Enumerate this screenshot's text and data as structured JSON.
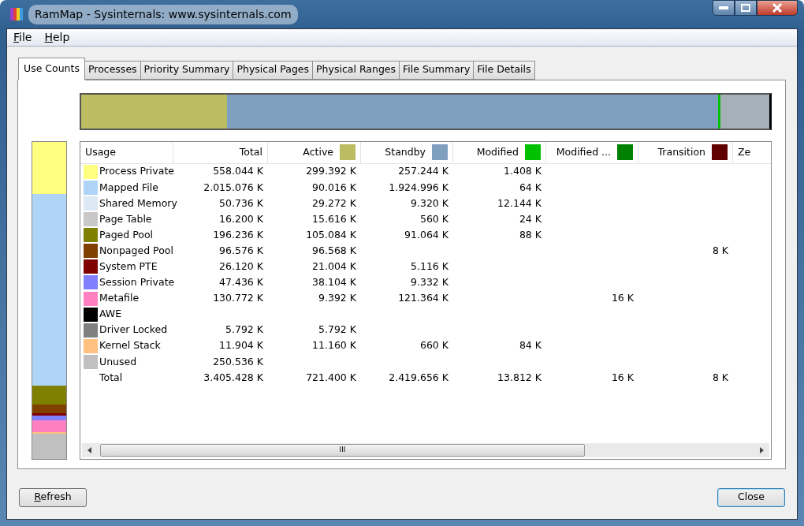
{
  "window": {
    "title": "RamMap - Sysinternals: www.sysinternals.com"
  },
  "menu": [
    {
      "label": "File"
    },
    {
      "label": "Help"
    }
  ],
  "tabs": [
    {
      "label": "Use Counts",
      "selected": true
    },
    {
      "label": "Processes",
      "selected": false
    },
    {
      "label": "Priority Summary",
      "selected": false
    },
    {
      "label": "Physical Pages",
      "selected": false
    },
    {
      "label": "Physical Ranges",
      "selected": false
    },
    {
      "label": "File Summary",
      "selected": false
    },
    {
      "label": "File Details",
      "selected": false
    }
  ],
  "table": {
    "columns": [
      {
        "label": "Usage"
      },
      {
        "label": "Total"
      },
      {
        "label": "Active",
        "color": "#bcbc62"
      },
      {
        "label": "Standby",
        "color": "#7f9fbf"
      },
      {
        "label": "Modified",
        "color": "#00c000"
      },
      {
        "label": "Modified ...",
        "color": "#008000"
      },
      {
        "label": "Transition",
        "color": "#600000"
      },
      {
        "label": "Ze"
      }
    ],
    "rows": [
      {
        "color": "#ffff80",
        "cells": [
          "Process Private",
          "558.044 K",
          "299.392 K",
          "257.244 K",
          "1.408 K",
          null,
          null,
          null
        ]
      },
      {
        "color": "#b0d4f8",
        "cells": [
          "Mapped File",
          "2.015.076 K",
          "90.016 K",
          "1.924.996 K",
          "64 K",
          null,
          null,
          null
        ]
      },
      {
        "color": "#dce8f4",
        "cells": [
          "Shared Memory",
          "50.736 K",
          "29.272 K",
          "9.320 K",
          "12.144 K",
          null,
          null,
          null
        ]
      },
      {
        "color": "#c8c8c8",
        "cells": [
          "Page Table",
          "16.200 K",
          "15.616 K",
          "560 K",
          "24 K",
          null,
          null,
          null
        ]
      },
      {
        "color": "#808000",
        "cells": [
          "Paged Pool",
          "196.236 K",
          "105.084 K",
          "91.064 K",
          "88 K",
          null,
          null,
          null
        ]
      },
      {
        "color": "#804000",
        "cells": [
          "Nonpaged Pool",
          "96.576 K",
          "96.568 K",
          null,
          null,
          null,
          "8 K",
          null
        ]
      },
      {
        "color": "#800000",
        "cells": [
          "System PTE",
          "26.120 K",
          "21.004 K",
          "5.116 K",
          null,
          null,
          null,
          null
        ]
      },
      {
        "color": "#8080ff",
        "cells": [
          "Session Private",
          "47.436 K",
          "38.104 K",
          "9.332 K",
          null,
          null,
          null,
          null
        ]
      },
      {
        "color": "#ff80c0",
        "cells": [
          "Metafile",
          "130.772 K",
          "9.392 K",
          "121.364 K",
          null,
          "16 K",
          null,
          null
        ]
      },
      {
        "color": "#000000",
        "cells": [
          "AWE",
          null,
          null,
          null,
          null,
          null,
          null,
          null
        ]
      },
      {
        "color": "#808080",
        "cells": [
          "Driver Locked",
          "5.792 K",
          "5.792 K",
          null,
          null,
          null,
          null,
          null
        ]
      },
      {
        "color": "#ffc080",
        "cells": [
          "Kernel Stack",
          "11.904 K",
          "11.160 K",
          "660 K",
          "84 K",
          null,
          null,
          null
        ]
      },
      {
        "color": "#c0c0c0",
        "cells": [
          "Unused",
          "250.536 K",
          null,
          null,
          null,
          null,
          null,
          null
        ]
      },
      {
        "cells": [
          "Total",
          "3.405.428 K",
          "721.400 K",
          "2.419.656 K",
          "13.812 K",
          "16 K",
          "8 K",
          null
        ]
      }
    ]
  },
  "scrollbar_grip": "III",
  "buttons": [
    {
      "label": "Refresh",
      "kind": "left"
    },
    {
      "label": "Close",
      "kind": "right"
    }
  ]
}
